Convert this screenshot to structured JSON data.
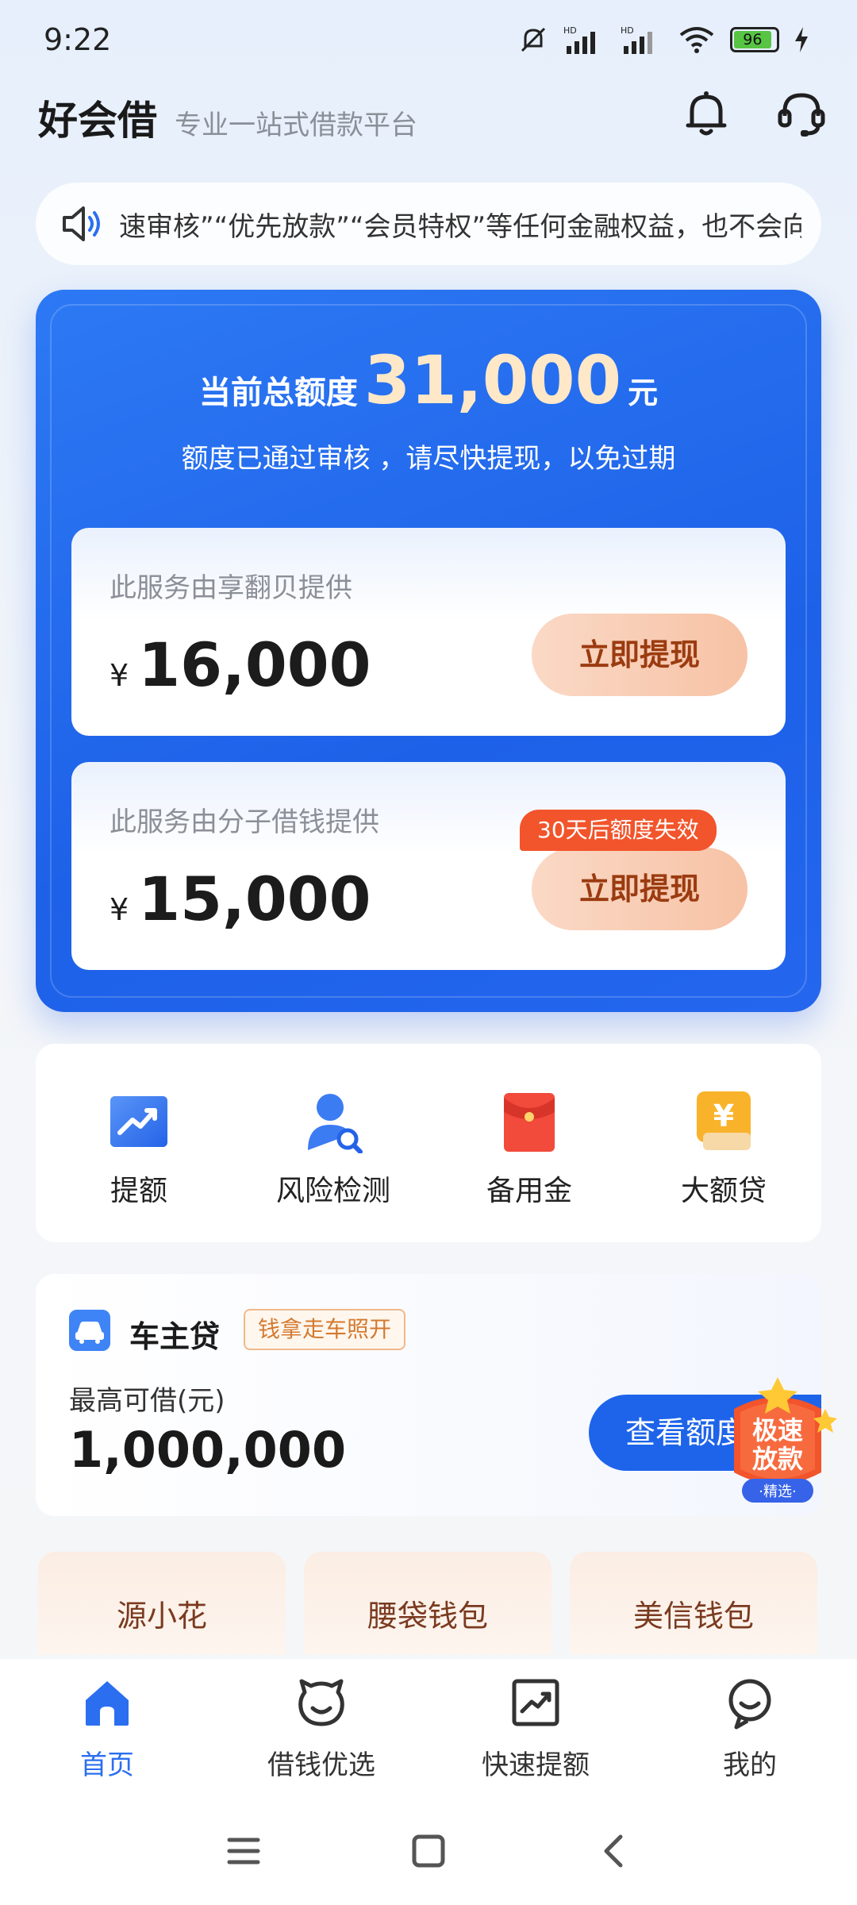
{
  "status": {
    "time": "9:22",
    "battery": "96"
  },
  "header": {
    "title": "好会借",
    "subtitle": "专业一站式借款平台"
  },
  "notice": {
    "text": "速审核”“优先放款”“会员特权”等任何金融权益，也不会向其"
  },
  "credit": {
    "label": "当前总额度",
    "amount": "31,000",
    "unit": "元",
    "note": "额度已通过审核 ，请尽快提现，以免过期",
    "loans": [
      {
        "provider": "此服务由享翻贝提供",
        "currency": "¥",
        "amount": "16,000",
        "button": "立即提现"
      },
      {
        "provider": "此服务由分子借钱提供",
        "currency": "¥",
        "amount": "15,000",
        "button": "立即提现",
        "badge": "30天后额度失效"
      }
    ]
  },
  "actions": [
    {
      "label": "提额",
      "icon": "chart-up-icon"
    },
    {
      "label": "风险检测",
      "icon": "user-search-icon"
    },
    {
      "label": "备用金",
      "icon": "red-envelope-icon"
    },
    {
      "label": "大额贷",
      "icon": "yen-coin-icon"
    }
  ],
  "car_loan": {
    "title": "车主贷",
    "tag": "钱拿走车照开",
    "max_label": "最高可借(元)",
    "max_amount": "1,000,000",
    "button": "查看额度",
    "badge_line1": "极速",
    "badge_line2": "放款",
    "badge_line3": "·精选·"
  },
  "partners": [
    "源小花",
    "腰袋钱包",
    "美信钱包"
  ],
  "bottom_nav": [
    {
      "label": "首页",
      "icon": "home-icon",
      "active": true
    },
    {
      "label": "借钱优选",
      "icon": "mascot-icon",
      "active": false
    },
    {
      "label": "快速提额",
      "icon": "chart-frame-icon",
      "active": false
    },
    {
      "label": "我的",
      "icon": "profile-icon",
      "active": false
    }
  ],
  "colors": {
    "primary": "#2b6ff0",
    "card_blue": "#1d61e8",
    "accent_orange": "#f2542b"
  }
}
